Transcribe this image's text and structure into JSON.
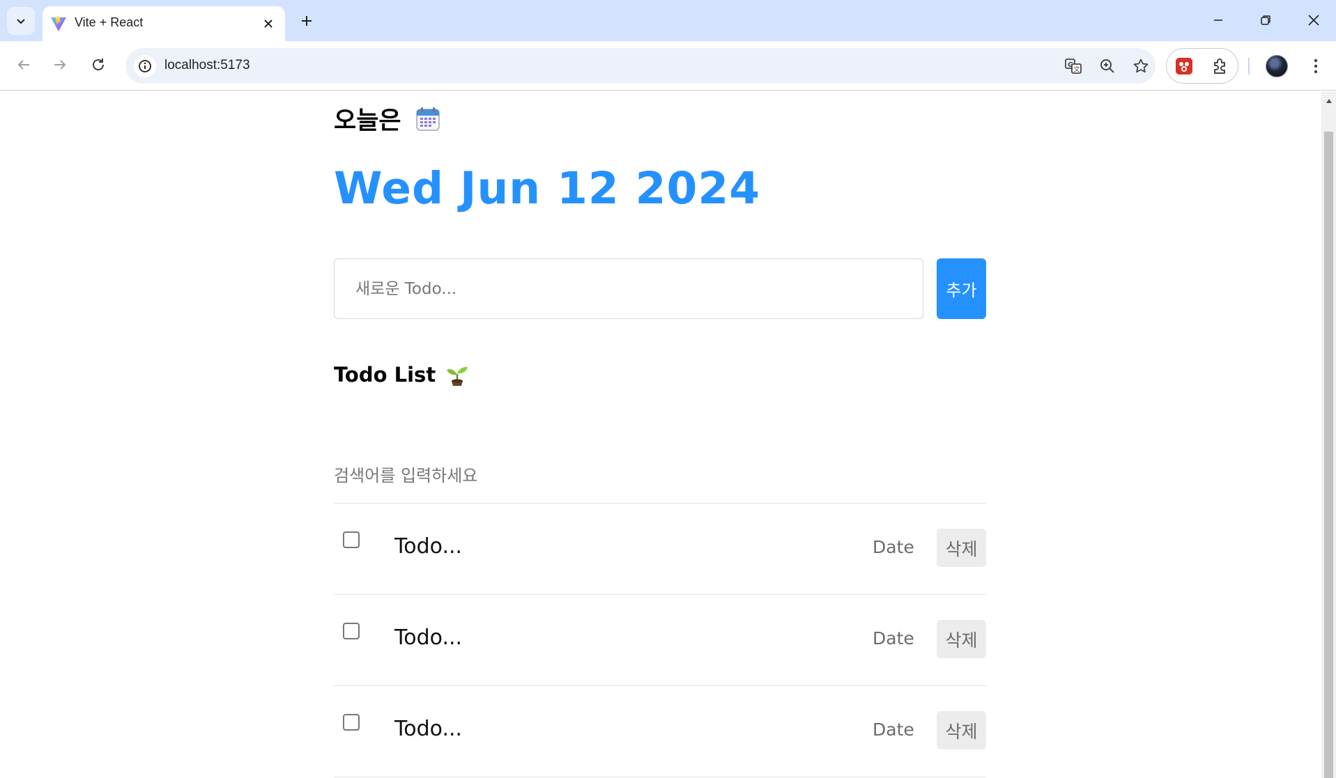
{
  "browser": {
    "tab_title": "Vite + React",
    "url": "localhost:5173",
    "colors": {
      "chrome_bg": "#d3e3fd",
      "omnibox_bg": "#edf2fa"
    }
  },
  "app": {
    "today_label": "오늘은",
    "date": "Wed Jun 12 2024",
    "new_todo_placeholder": "새로운 Todo...",
    "add_button_label": "추가",
    "list_title": "Todo List",
    "search_placeholder": "검색어를 입력하세요",
    "todos": [
      {
        "content": "Todo...",
        "date": "Date",
        "delete_label": "삭제",
        "done": false
      },
      {
        "content": "Todo...",
        "date": "Date",
        "delete_label": "삭제",
        "done": false
      },
      {
        "content": "Todo...",
        "date": "Date",
        "delete_label": "삭제",
        "done": false
      }
    ],
    "colors": {
      "accent": "#2591ff",
      "delete_bg": "#ececec"
    }
  },
  "icons": {
    "today": "calendar-icon",
    "list": "seedling-icon"
  }
}
